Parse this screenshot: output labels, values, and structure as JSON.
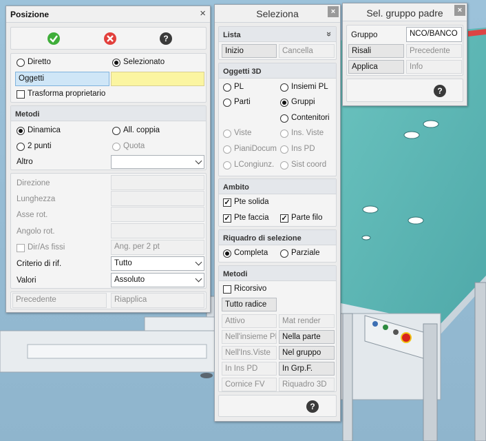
{
  "posizione": {
    "title": "Posizione",
    "close": "×",
    "confirm_icon": "check-circle-green",
    "cancel_icon": "x-circle-red",
    "help_icon": "help-circle",
    "help_glyph": "?",
    "diretto": "Diretto",
    "selezionato": "Selezionato",
    "oggetti": "Oggetti",
    "trasforma": "Trasforma proprietario",
    "metodi_header": "Metodi",
    "dinamica": "Dinamica",
    "all_coppia": "All. coppia",
    "due_punti": "2 punti",
    "quota": "Quota",
    "altro": "Altro",
    "altro_value": "",
    "direzione": "Direzione",
    "lunghezza": "Lunghezza",
    "asse_rot": "Asse rot.",
    "angolo_rot": "Angolo rot.",
    "dir_as_fissi": "Dir/As fissi",
    "ang_per_2pt": "Ang. per 2 pt",
    "criterio": "Criterio di rif.",
    "criterio_value": "Tutto",
    "valori": "Valori",
    "valori_value": "Assoluto",
    "precedente": "Precedente",
    "riapplica": "Riapplica"
  },
  "seleziona": {
    "title": "Seleziona",
    "close": "×",
    "lista_header": "Lista",
    "lista_collapse_icon": "double-chevron-icon",
    "lista_collapse_glyph": "»",
    "inizio": "Inizio",
    "cancella": "Cancella",
    "oggetti3d_header": "Oggetti 3D",
    "pl": "PL",
    "insiemi_pl": "Insiemi PL",
    "parti": "Parti",
    "gruppi": "Gruppi",
    "contenitori": "Contenitori",
    "viste": "Viste",
    "ins_viste": "Ins. Viste",
    "piani_docum": "PianiDocum",
    "ins_pd": "Ins PD",
    "lcongiunz": "LCongiunz.",
    "sist_coord": "Sist coord",
    "ambito_header": "Ambito",
    "pte_solida": "Pte solida",
    "pte_faccia": "Pte faccia",
    "parte_filo": "Parte filo",
    "riquadro_header": "Riquadro di selezione",
    "completa": "Completa",
    "parziale": "Parziale",
    "metodi_header": "Metodi",
    "ricorsivo": "Ricorsivo",
    "tutto_radice": "Tutto radice",
    "attivo": "Attivo",
    "mat_render": "Mat render",
    "nell_insieme_pl": "Nell'insieme PL",
    "nella_parte": "Nella parte",
    "nell_ins_viste": "Nell'Ins.Viste",
    "nel_gruppo": "Nel gruppo",
    "in_ins_pd": "In Ins PD",
    "in_grp_f": "In Grp.F.",
    "cornice_fv": "Cornice FV",
    "riquadro_3d": "Riquadro 3D",
    "help_glyph": "?"
  },
  "gruppo_padre": {
    "title": "Sel. gruppo padre",
    "close": "×",
    "gruppo": "Gruppo",
    "gruppo_value": "NCO/BANCO",
    "risali": "Risali",
    "precedente": "Precedente",
    "applica": "Applica",
    "info": "Info",
    "help_glyph": "?"
  },
  "colors": {
    "table_top": "#5fb8b5",
    "frame": "#dfe4e8",
    "floor": "#9fbfd4",
    "highlight_yellow": "#fbf5a1",
    "selected_field": "#cfe6f7"
  }
}
